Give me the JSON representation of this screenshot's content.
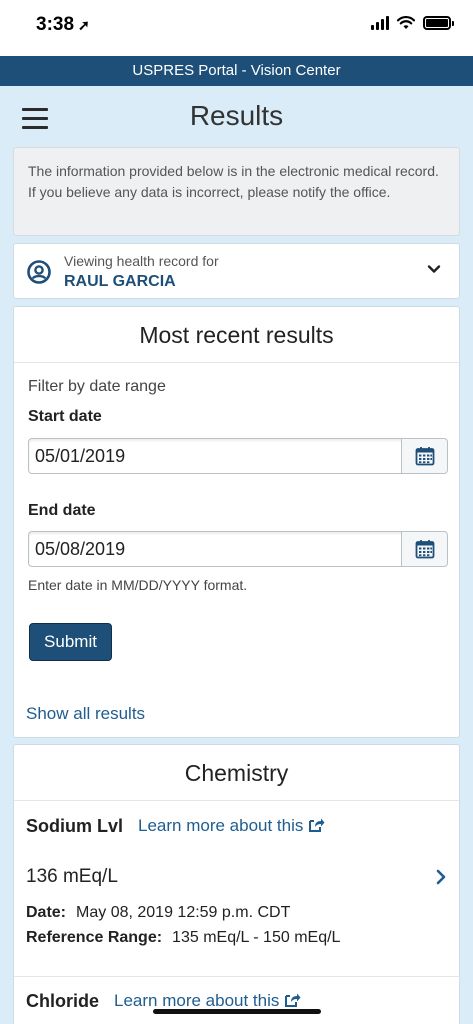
{
  "status_bar": {
    "time": "3:38",
    "location_arrow": "location-arrow-icon"
  },
  "portal": {
    "title": "USPRES Portal - Vision Center"
  },
  "header": {
    "title": "Results"
  },
  "notice": {
    "text": "The information provided below is in the electronic medical record. If you believe any data is incorrect, please notify the office."
  },
  "patient": {
    "viewing_label": "Viewing health record for",
    "name": "RAUL GARCIA"
  },
  "results": {
    "title": "Most recent results",
    "filter_label": "Filter by date range",
    "start_label": "Start date",
    "start_value": "05/01/2019",
    "end_label": "End date",
    "end_value": "05/08/2019",
    "hint": "Enter date in MM/DD/YYYY format.",
    "submit_label": "Submit",
    "show_all_label": "Show all results"
  },
  "chemistry": {
    "title": "Chemistry",
    "tests": [
      {
        "name": "Sodium Lvl",
        "learn_more": "Learn more about this",
        "value": "136 mEq/L",
        "date_label": "Date:",
        "date_value": "May 08, 2019 12:59 p.m. CDT",
        "range_label": "Reference Range:",
        "range_value": "135 mEq/L - 150 mEq/L"
      },
      {
        "name": "Chloride",
        "learn_more": "Learn more about this"
      }
    ]
  },
  "colors": {
    "brand": "#1e4f78",
    "link": "#1f5d8f",
    "background": "#d9ecf7"
  }
}
